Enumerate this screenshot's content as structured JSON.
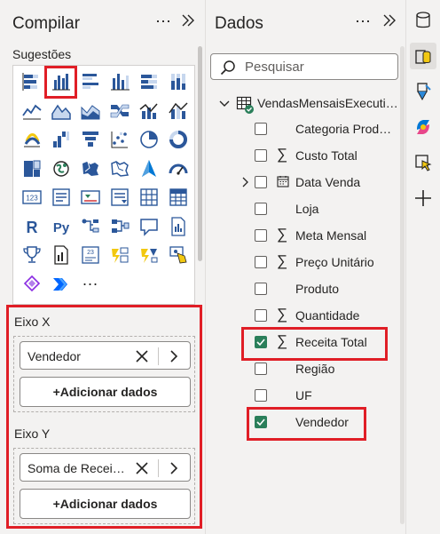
{
  "build_pane": {
    "title": "Compilar",
    "more_label": "⋯",
    "suggestions_label": "Sugestões",
    "visuals": [
      "stacked-bar-chart-icon",
      "clustered-column-chart-icon",
      "clustered-bar-chart-icon",
      "stacked-column-chart-icon",
      "100pct-stacked-bar-chart-icon",
      "100pct-stacked-column-chart-icon",
      "line-chart-icon",
      "area-chart-icon",
      "stacked-area-chart-icon",
      "ribbon-chart-icon",
      "line-and-column-chart-icon",
      "line-and-stacked-column-chart-icon",
      "waterfall-chart-icon",
      "funnel-chart-icon",
      "column-stacked-icon",
      "scatter-chart-icon",
      "pie-chart-icon",
      "donut-chart-icon",
      "treemap-icon",
      "globe-map-icon",
      "filled-map-icon",
      "shape-map-icon",
      "azure-map-icon",
      "gauge-icon",
      "card-icon",
      "multi-row-card-icon",
      "kpi-icon",
      "slicer-icon",
      "table-visual-icon",
      "matrix-visual-icon",
      "r-script-visual-icon",
      "python-visual-icon",
      "decomposition-tree-icon",
      "key-influencers-icon",
      "qa-visual-icon",
      "paginated-report-icon",
      "trophy-icon",
      "report-page-icon",
      "smart-narrative-icon",
      "power-automate-icon",
      "power-apps-icon",
      "custom-visual-icon",
      "metrics-icon",
      "power-automate-chevron-icon",
      "more-visuals-icon"
    ],
    "more_visuals_label": "···",
    "selected_visual_index": 1,
    "wells": {
      "x_axis": {
        "title": "Eixo X",
        "field": "Vendedor",
        "add_label": "+Adicionar dados"
      },
      "y_axis": {
        "title": "Eixo Y",
        "field": "Soma de Recei…",
        "add_label": "+Adicionar dados"
      }
    }
  },
  "data_pane": {
    "title": "Dados",
    "more_label": "⋯",
    "search_placeholder": "Pesquisar",
    "table_name": "VendasMensaisExecuti…",
    "fields": [
      {
        "name": "Categoria Prod…",
        "sigma": false,
        "date": false,
        "expand": false,
        "checked": false
      },
      {
        "name": "Custo Total",
        "sigma": true,
        "date": false,
        "expand": false,
        "checked": false
      },
      {
        "name": "Data Venda",
        "sigma": false,
        "date": true,
        "expand": true,
        "checked": false
      },
      {
        "name": "Loja",
        "sigma": false,
        "date": false,
        "expand": false,
        "checked": false
      },
      {
        "name": "Meta Mensal",
        "sigma": true,
        "date": false,
        "expand": false,
        "checked": false
      },
      {
        "name": "Preço Unitário",
        "sigma": true,
        "date": false,
        "expand": false,
        "checked": false
      },
      {
        "name": "Produto",
        "sigma": false,
        "date": false,
        "expand": false,
        "checked": false
      },
      {
        "name": "Quantidade",
        "sigma": true,
        "date": false,
        "expand": false,
        "checked": false
      },
      {
        "name": "Receita Total",
        "sigma": true,
        "date": false,
        "expand": false,
        "checked": true
      },
      {
        "name": "Região",
        "sigma": false,
        "date": false,
        "expand": false,
        "checked": false
      },
      {
        "name": "UF",
        "sigma": false,
        "date": false,
        "expand": false,
        "checked": false
      },
      {
        "name": "Vendedor",
        "sigma": false,
        "date": false,
        "expand": false,
        "checked": true
      }
    ],
    "sigma_glyph": "∑"
  },
  "rail": {
    "buttons": [
      "database-icon",
      "data-pane-icon",
      "format-brush-icon",
      "copilot-icon",
      "select-cursor-icon",
      "add-icon"
    ],
    "active_index": 1
  },
  "colors": {
    "highlight_red": "#e01e26",
    "check_green": "#2a7f5a",
    "pane_bg": "#f3f2f1",
    "accent_blue": "#2b579a"
  }
}
